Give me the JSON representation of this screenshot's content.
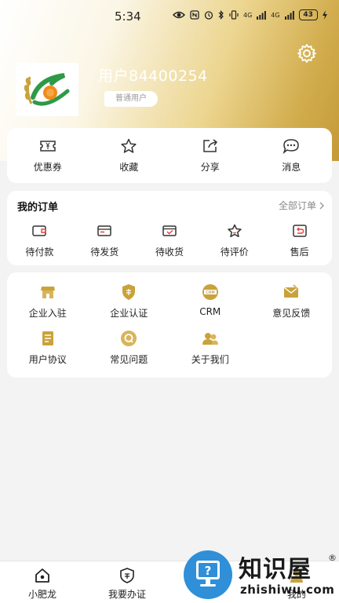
{
  "status_bar": {
    "time": "5:34",
    "signal_1": "4G",
    "signal_2": "4G",
    "battery": "43"
  },
  "header": {
    "username": "用户84400254",
    "user_level": "普通用户"
  },
  "quick_actions": [
    {
      "label": "优惠券",
      "icon": "coupon-icon"
    },
    {
      "label": "收藏",
      "icon": "star-icon"
    },
    {
      "label": "分享",
      "icon": "share-icon"
    },
    {
      "label": "消息",
      "icon": "message-icon"
    }
  ],
  "orders": {
    "title": "我的订单",
    "view_all": "全部订单",
    "items": [
      {
        "label": "待付款",
        "icon": "wallet-icon"
      },
      {
        "label": "待发货",
        "icon": "box-icon"
      },
      {
        "label": "待收货",
        "icon": "receive-icon"
      },
      {
        "label": "待评价",
        "icon": "star-icon"
      },
      {
        "label": "售后",
        "icon": "return-icon"
      }
    ]
  },
  "services": [
    {
      "label": "企业入驻",
      "icon": "shop-icon"
    },
    {
      "label": "企业认证",
      "icon": "shield-icon"
    },
    {
      "label": "CRM",
      "icon": "crm-icon",
      "icon_text": "CRM"
    },
    {
      "label": "意见反馈",
      "icon": "mail-icon"
    },
    {
      "label": "用户协议",
      "icon": "document-icon"
    },
    {
      "label": "常见问题",
      "icon": "question-icon"
    },
    {
      "label": "关于我们",
      "icon": "people-icon"
    }
  ],
  "tabbar": [
    {
      "label": "小肥龙",
      "icon": "home-icon"
    },
    {
      "label": "我要办证",
      "icon": "certificate-icon"
    },
    {
      "label": "",
      "icon": ""
    },
    {
      "label": "我的",
      "icon": "user-icon"
    }
  ],
  "watermark": {
    "title": "知识屋",
    "subtitle": "zhishiwu.com",
    "reg": "®"
  },
  "colors": {
    "gold": "#c49a36",
    "icon_stroke": "#333333",
    "accent_red": "#e0473c"
  }
}
